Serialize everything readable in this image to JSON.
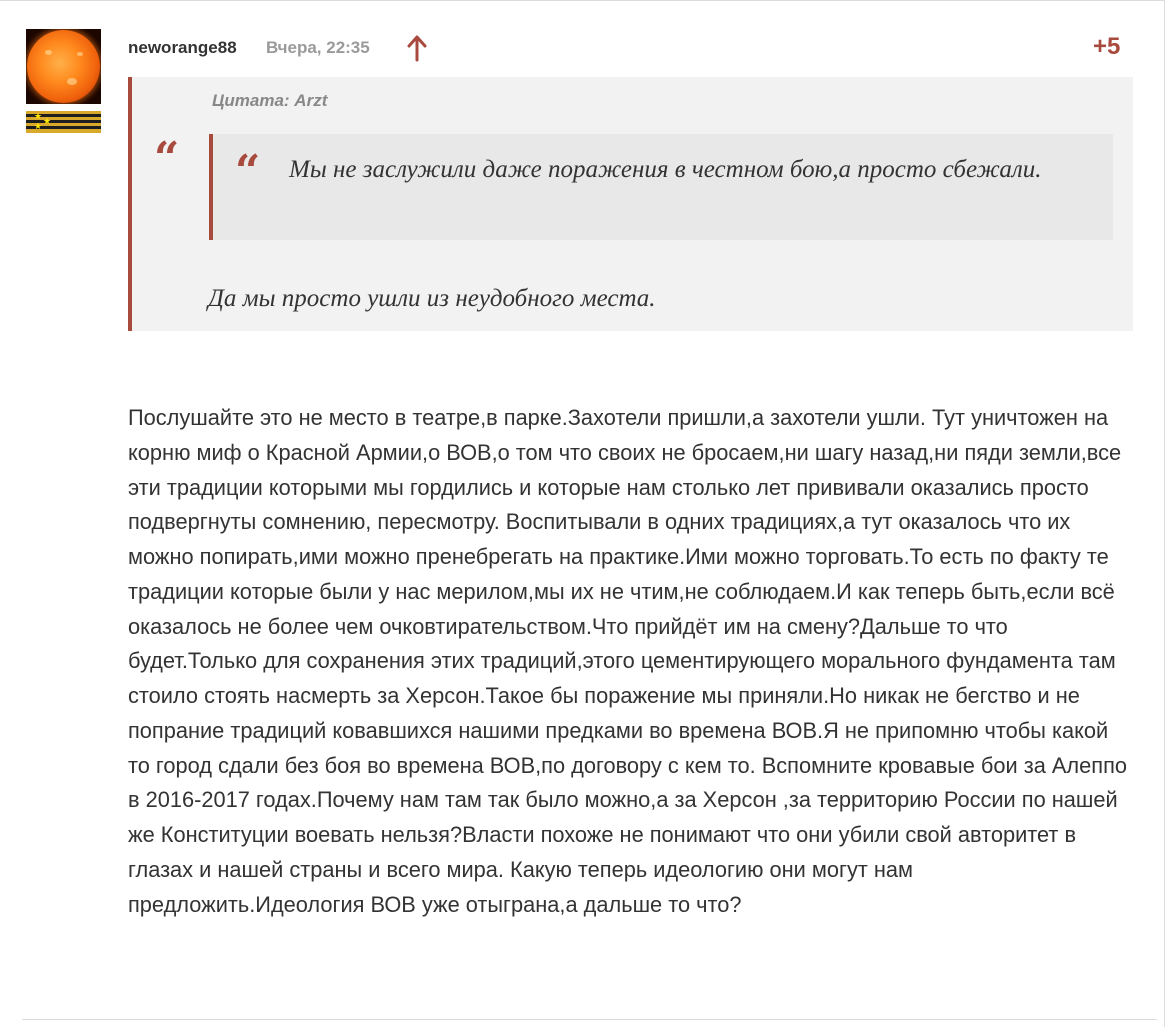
{
  "comment": {
    "author": "neworange88",
    "time": "Вчера, 22:35",
    "score": "+5",
    "upvote_icon": "arrow-up-icon",
    "accent_color": "#a94a3e",
    "quote": {
      "source": "Цитата: Arzt",
      "nested_quote_text": "Мы не заслужили даже поражения в честном бою,а просто сбежали.",
      "reply_text": "Да мы просто ушли из неудобного места."
    },
    "body": "Послушайте это не место в театре,в парке.Захотели пришли,а захотели ушли. Тут уничтожен на корню миф о Красной Армии,о ВОВ,о том что своих не бросаем,ни шагу назад,ни пяди земли,все эти традиции которыми мы гордились и которые нам столько лет прививали оказались просто подвергнуты сомнению, пересмотру. Воспитывали в одних традициях,а тут оказалось что их можно попирать,ими можно пренебрегать на практике.Ими можно торговать.То есть по факту те традиции которые были у нас мерилом,мы их не чтим,не соблюдаем.И как теперь быть,если всё оказалось не более чем очковтирательством.Что прийдёт им на смену?Дальше то что будет.Только для сохранения этих традиций,этого цементирующего морального фундамента там стоило стоять насмерть за Херсон.Такое бы поражение мы приняли.Но никак не бегство и не попрание традиций ковавшихся нашими предками во времена ВОВ.Я не припомню чтобы какой то город сдали без боя во времена ВОВ,по договору с кем то. Вспомните кровавые бои за Алеппо в 2016-2017 годах.Почему нам там так было можно,а за Херсон ,за территорию России по нашей же Конституции воевать нельзя?Власти похоже не понимают что они убили свой авторитет в глазах и нашей страны и всего мира. Какую теперь идеологию они могут нам предложить.Идеология ВОВ уже отыграна,а дальше то что?"
  }
}
